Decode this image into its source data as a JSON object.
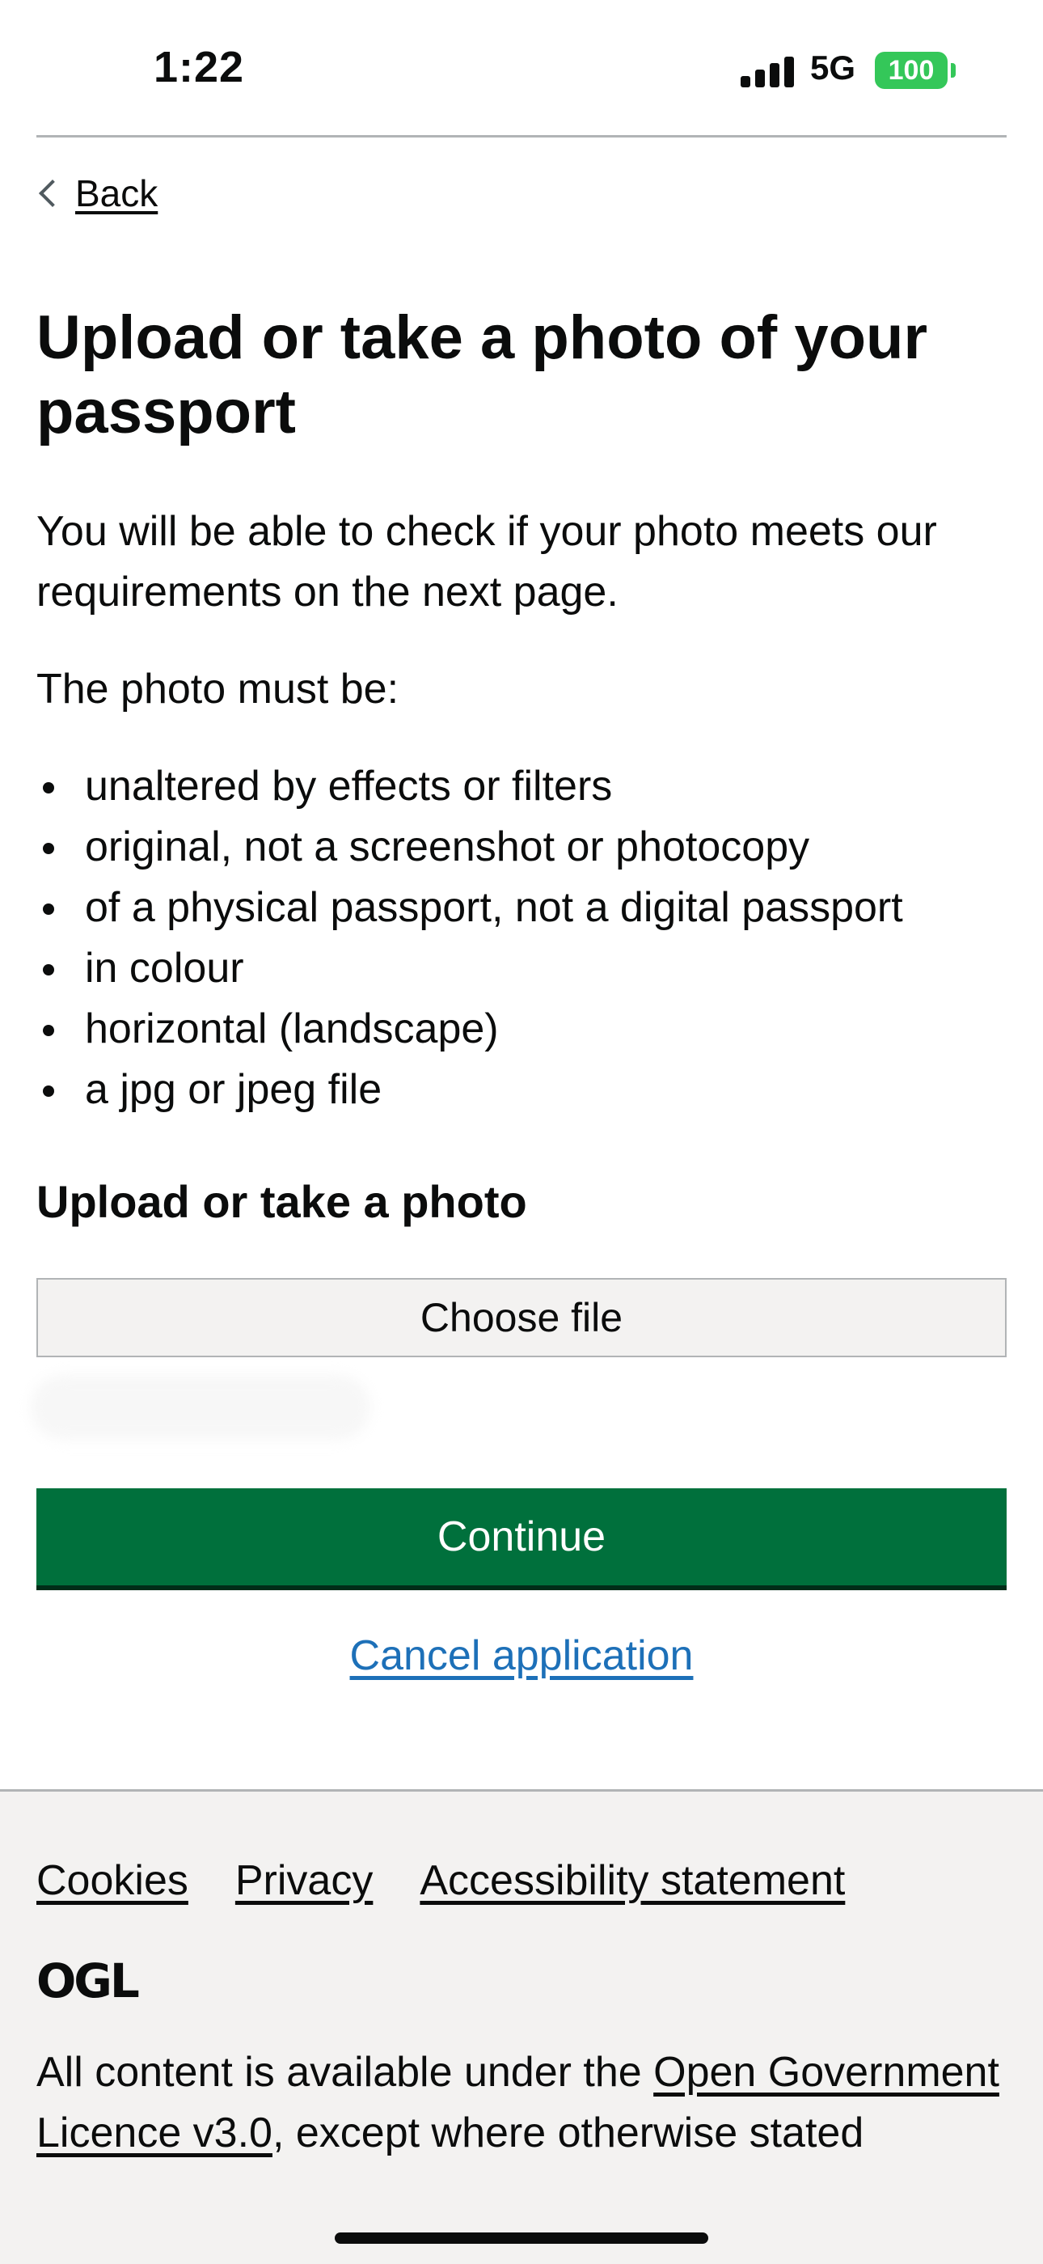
{
  "status_bar": {
    "time": "1:22",
    "network": "5G",
    "battery": "100"
  },
  "back": {
    "label": "Back"
  },
  "page": {
    "title": "Upload or take a photo of your passport",
    "intro": "You will be able to check if your photo meets our requirements on the next page.",
    "photo_must": "The photo must be:",
    "requirements": [
      "unaltered by effects or filters",
      "original, not a screenshot or photocopy",
      "of a physical passport, not a digital passport",
      "in colour",
      "horizontal (landscape)",
      "a jpg or jpeg file"
    ]
  },
  "upload": {
    "label": "Upload or take a photo",
    "button": "Choose file"
  },
  "actions": {
    "continue": "Continue",
    "cancel": "Cancel application"
  },
  "footer": {
    "links": [
      "Cookies",
      "Privacy",
      "Accessibility statement"
    ],
    "ogl": "OGL",
    "licence_prefix": "All content is available under the ",
    "licence_link": "Open Government Licence v3.0",
    "licence_suffix": ", except where otherwise stated"
  },
  "colors": {
    "primary_button": "#00703c",
    "link": "#1d70b8",
    "battery": "#34c759",
    "footer_bg": "#f3f2f1"
  }
}
